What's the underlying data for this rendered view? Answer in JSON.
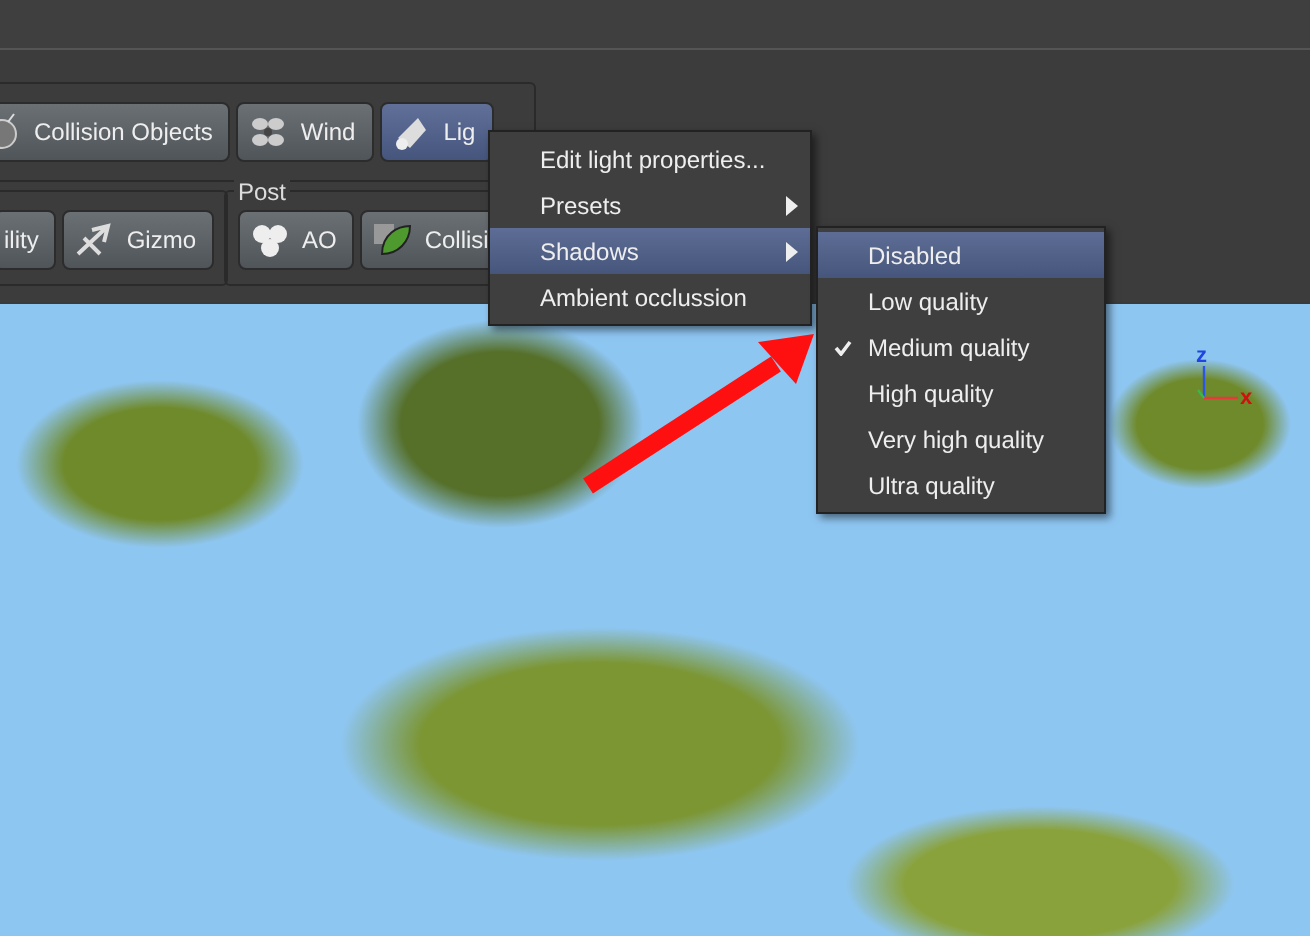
{
  "toolbar": {
    "row_1": [
      {
        "label": "Collision Objects",
        "selected": false
      },
      {
        "label": "Wind",
        "selected": false
      },
      {
        "label": "Lig",
        "selected": true
      }
    ],
    "row_2": [
      {
        "buttons": [
          {
            "label": "ility",
            "selected": false
          },
          {
            "label": "Gizmo",
            "selected": false
          }
        ]
      },
      {
        "title": "Post",
        "buttons": [
          {
            "label": "AO",
            "selected": false
          },
          {
            "label": "Collisi",
            "selected": false
          }
        ]
      }
    ]
  },
  "viewport": {
    "axis_gizmo": {
      "z_label": "z",
      "x_label": "x"
    }
  },
  "menu": {
    "items": [
      {
        "label": "Edit light properties...",
        "kind": "item",
        "selected": false
      },
      {
        "label": "Presets",
        "kind": "submenu",
        "selected": false
      },
      {
        "label": "Shadows",
        "kind": "submenu",
        "selected": true
      },
      {
        "label": "Ambient occlussion",
        "kind": "item",
        "selected": false
      }
    ]
  },
  "submenu": {
    "items": [
      {
        "label": "Disabled",
        "checked": false,
        "selected": true
      },
      {
        "label": "Low quality",
        "checked": false,
        "selected": false
      },
      {
        "label": "Medium quality",
        "checked": true,
        "selected": false
      },
      {
        "label": "High quality",
        "checked": false,
        "selected": false
      },
      {
        "label": "Very high quality",
        "checked": false,
        "selected": false
      },
      {
        "label": "Ultra quality",
        "checked": false,
        "selected": false
      }
    ]
  }
}
